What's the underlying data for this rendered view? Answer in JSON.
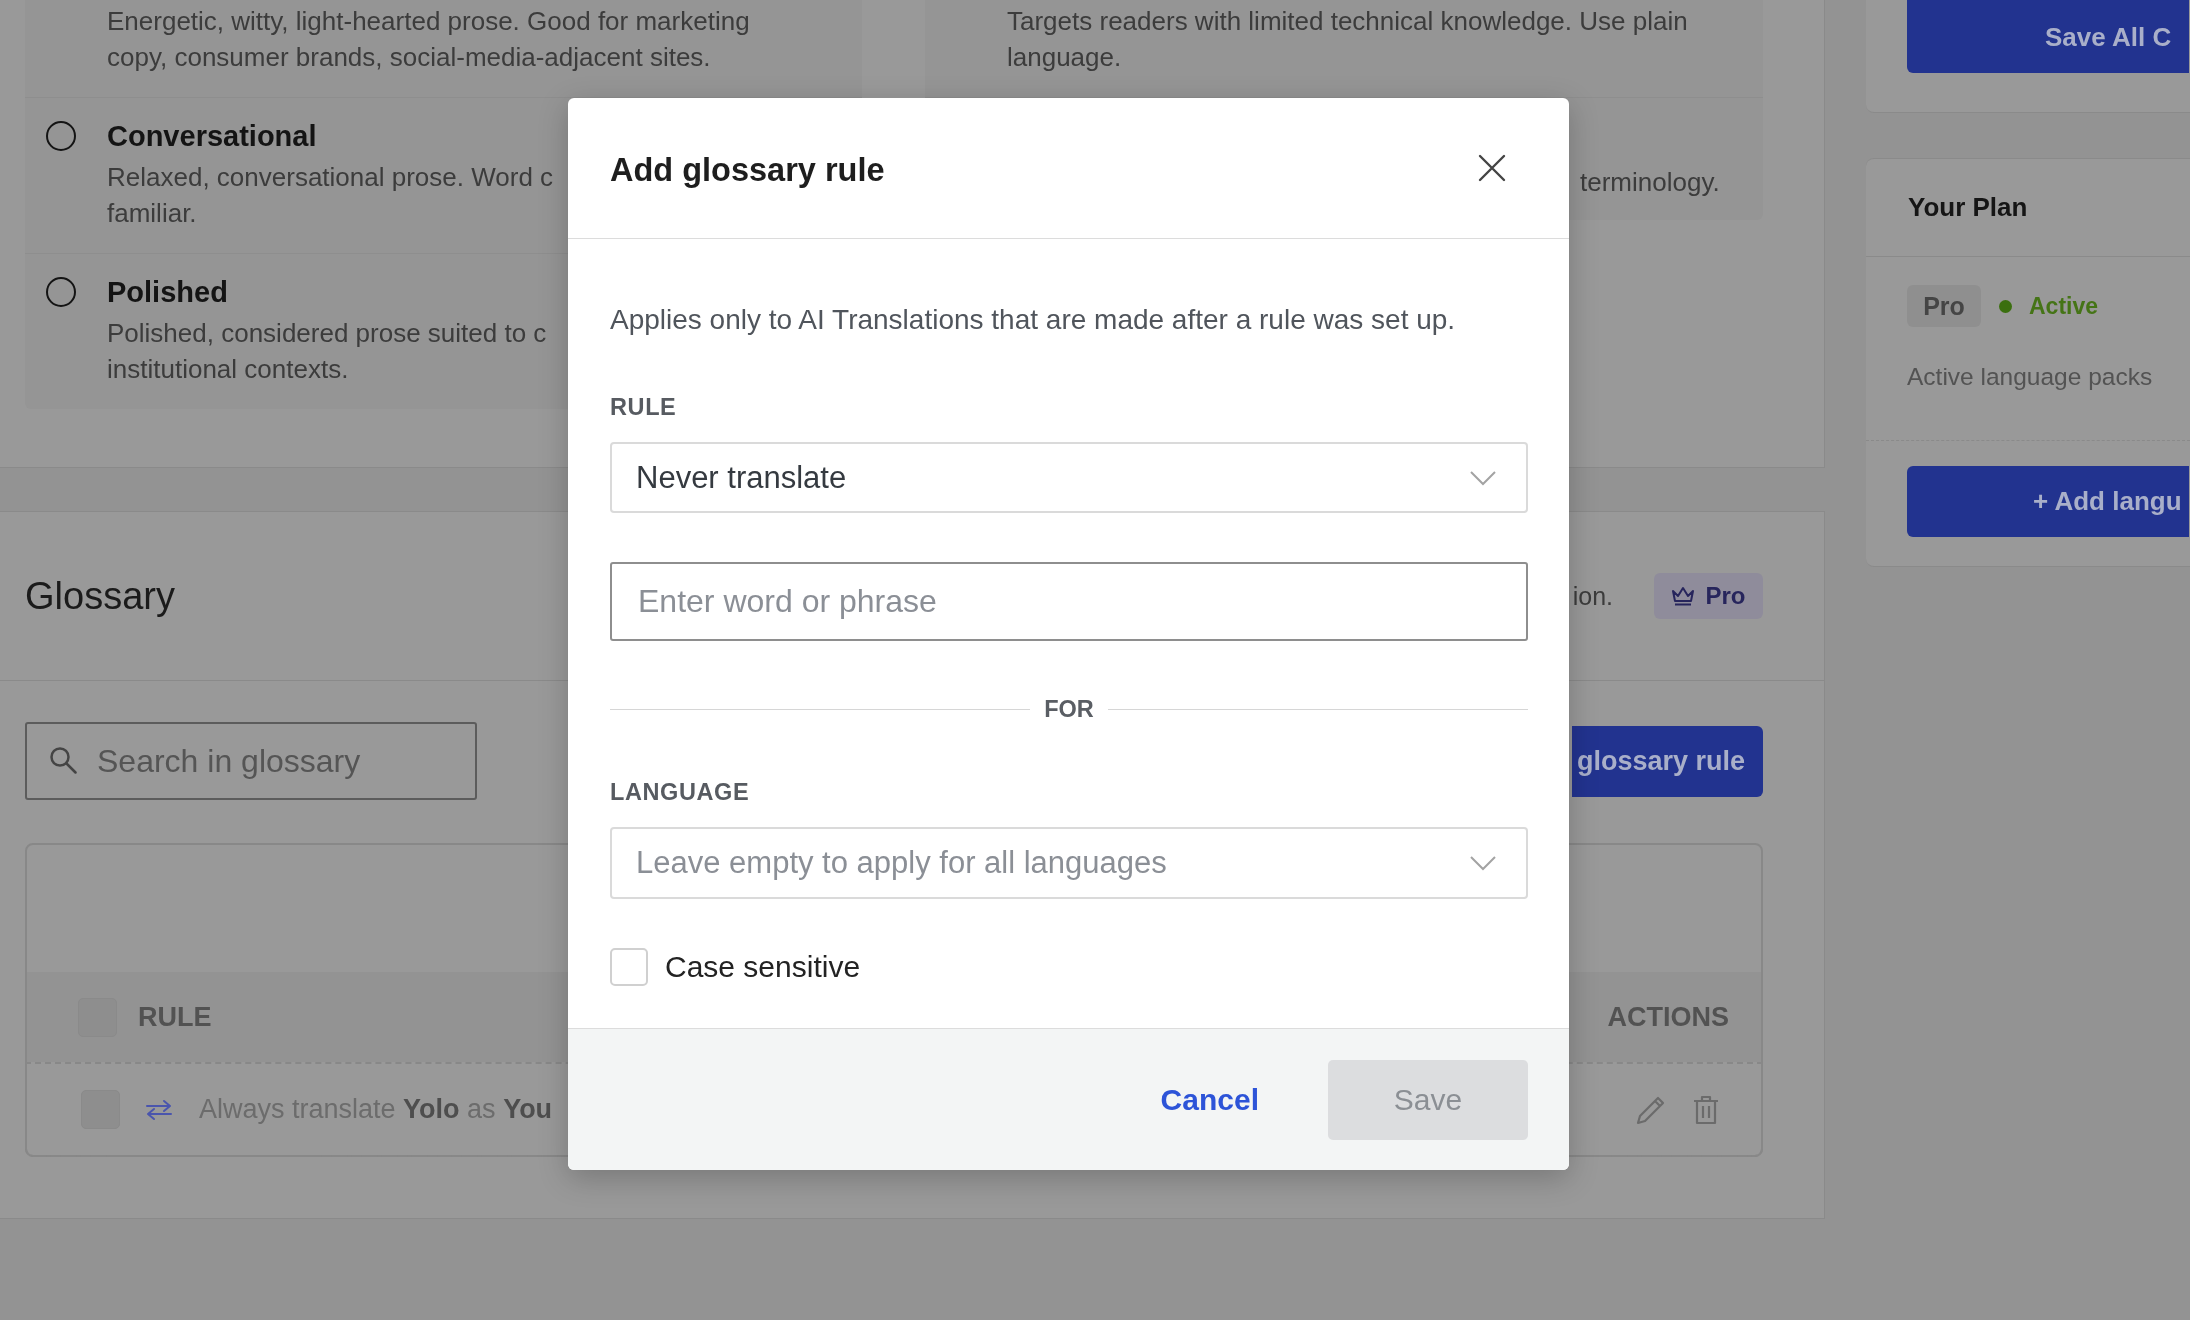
{
  "tones": {
    "left": [
      {
        "description": "Energetic, witty, light-hearted prose. Good for marketing\ncopy, consumer brands, social-media-adjacent sites."
      },
      {
        "title": "Conversational",
        "selected": false,
        "description": "Relaxed, conversational prose. Word c\nfamiliar."
      },
      {
        "title": "Polished",
        "selected": false,
        "description": "Polished, considered prose suited to c\ninstitutional contexts."
      }
    ],
    "right": [
      {
        "description": "Targets readers with limited technical knowledge. Use plain\nlanguage."
      },
      {
        "description": "terminology."
      }
    ]
  },
  "glossary": {
    "title": "Glossary",
    "description": "ion.",
    "badge": "Pro",
    "search": {
      "placeholder": "Search in glossary"
    },
    "add_button": "glossary rule",
    "table": {
      "select_all": {
        "checked": false
      },
      "columns": [
        "RULE",
        "ACTIONS"
      ],
      "rows": [
        {
          "checked": false,
          "text": "Always translate **Yolo** as **You**"
        }
      ]
    }
  },
  "save_all_button": "Save All C",
  "plan": {
    "title": "Your Plan",
    "tier": "Pro",
    "status": "Active",
    "packs_label": "Active language packs",
    "add_button": "+ Add langu"
  },
  "dialog": {
    "title": "Add glossary rule",
    "note": "Applies only to AI Translations that are made after a rule was set up.",
    "rule": {
      "label": "RULE",
      "value": "Never translate"
    },
    "phrase": {
      "placeholder": "Enter word or phrase"
    },
    "divider_label": "FOR",
    "language": {
      "label": "LANGUAGE",
      "placeholder": "Leave empty to apply for all languages"
    },
    "case_sensitive": {
      "label": "Case sensitive",
      "checked": false
    },
    "cancel": "Cancel",
    "save": {
      "label": "Save",
      "disabled": true
    }
  }
}
